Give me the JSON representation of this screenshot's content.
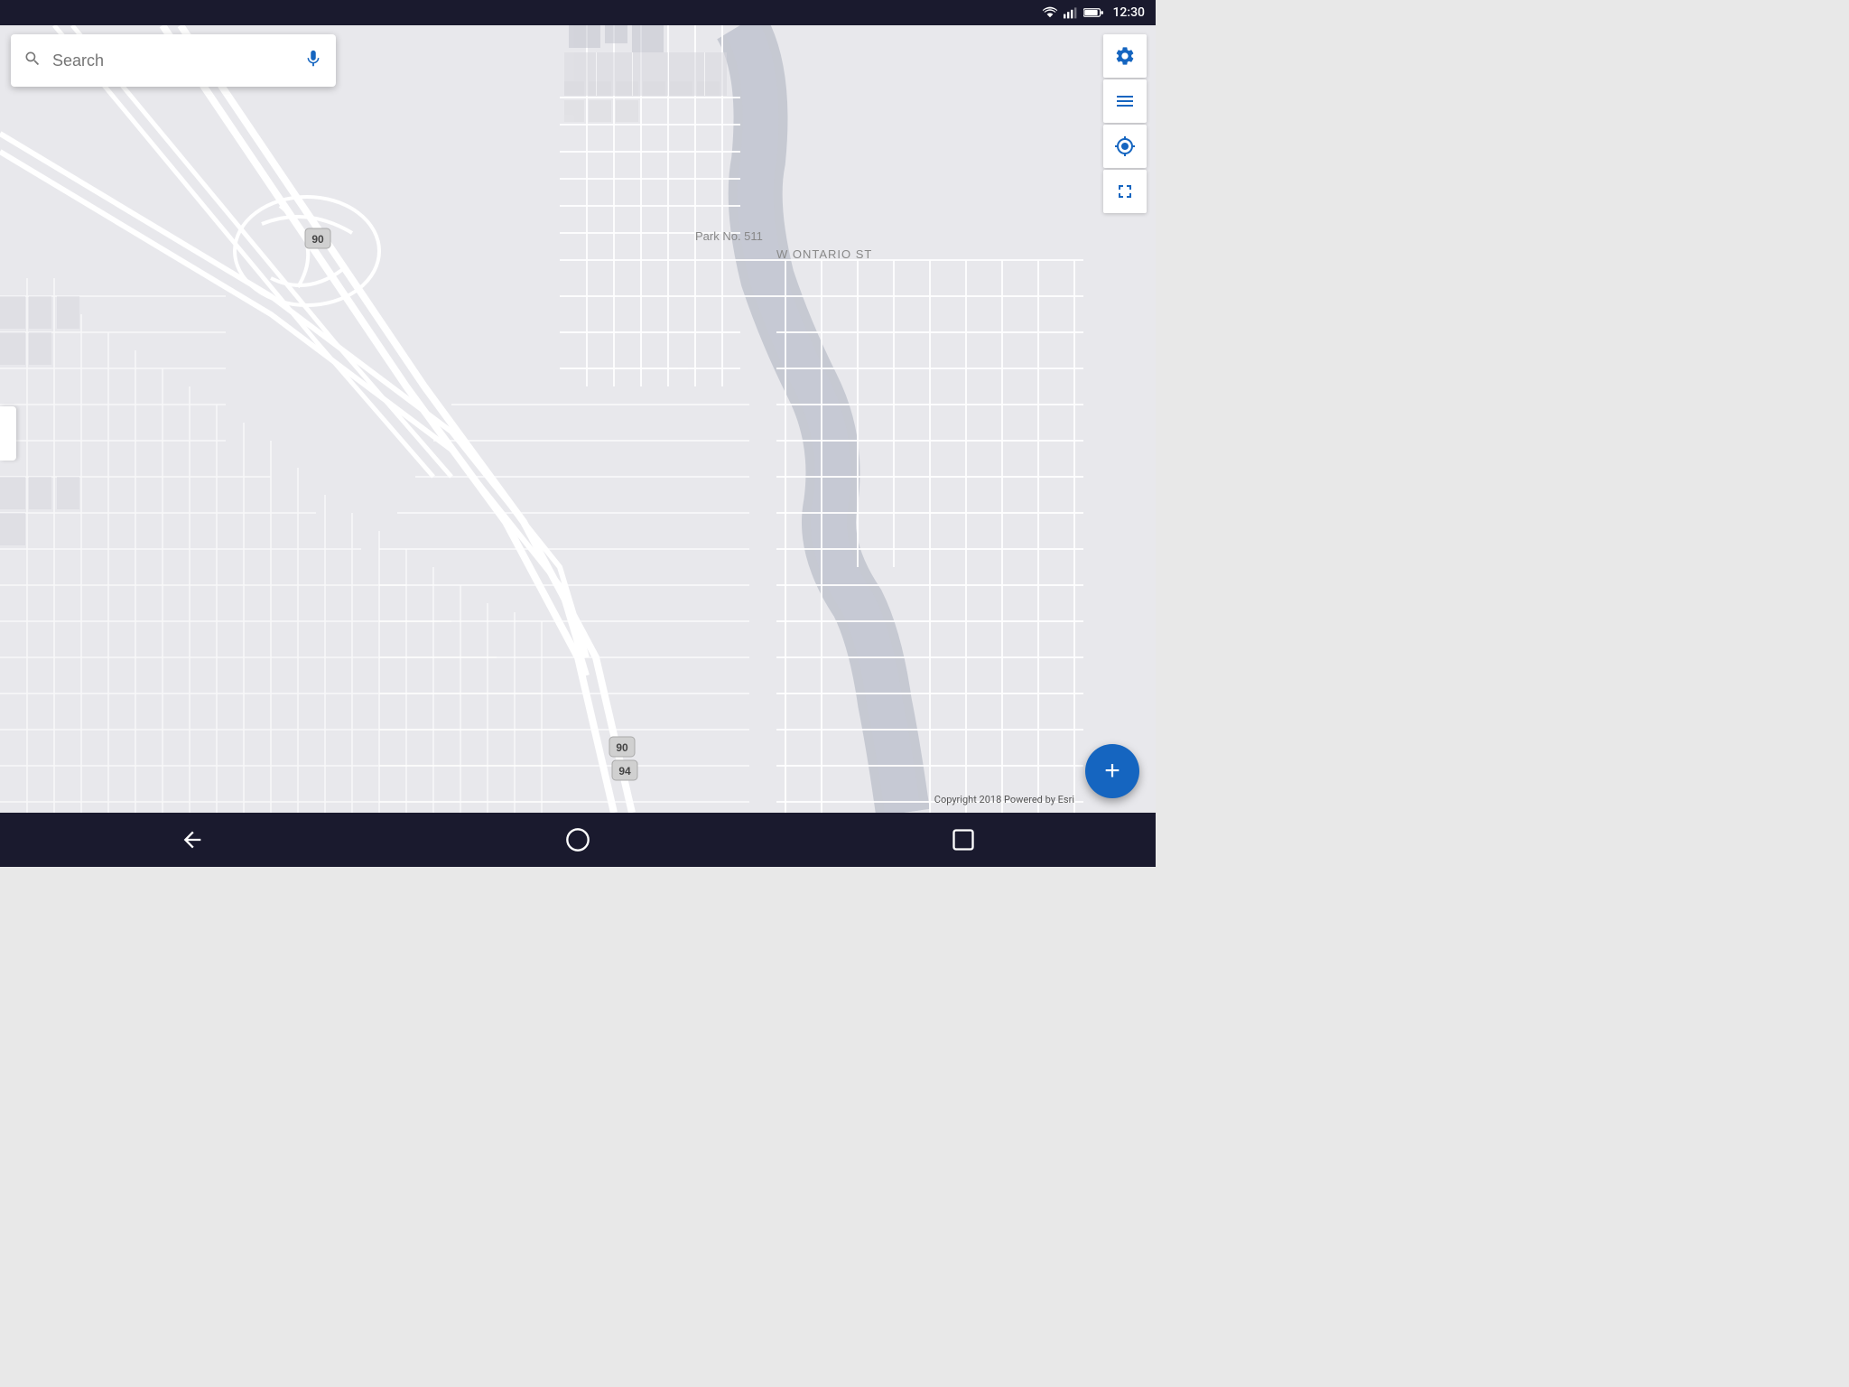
{
  "status_bar": {
    "time": "12:30",
    "icons": [
      "wifi",
      "signal",
      "battery"
    ]
  },
  "search": {
    "placeholder": "Search"
  },
  "toolbar": {
    "settings_label": "Settings",
    "layers_label": "Layers",
    "location_label": "My Location",
    "fullscreen_label": "Fullscreen"
  },
  "fab": {
    "label": "+"
  },
  "copyright": "Copyright 2018 Powered by Esri",
  "map_labels": {
    "park": "Park No. 511",
    "street": "W ONTARIO ST",
    "highway_90_1": "90",
    "highway_90_2": "90",
    "highway_94": "94"
  },
  "nav": {
    "back": "back",
    "home": "home",
    "recents": "recents"
  }
}
